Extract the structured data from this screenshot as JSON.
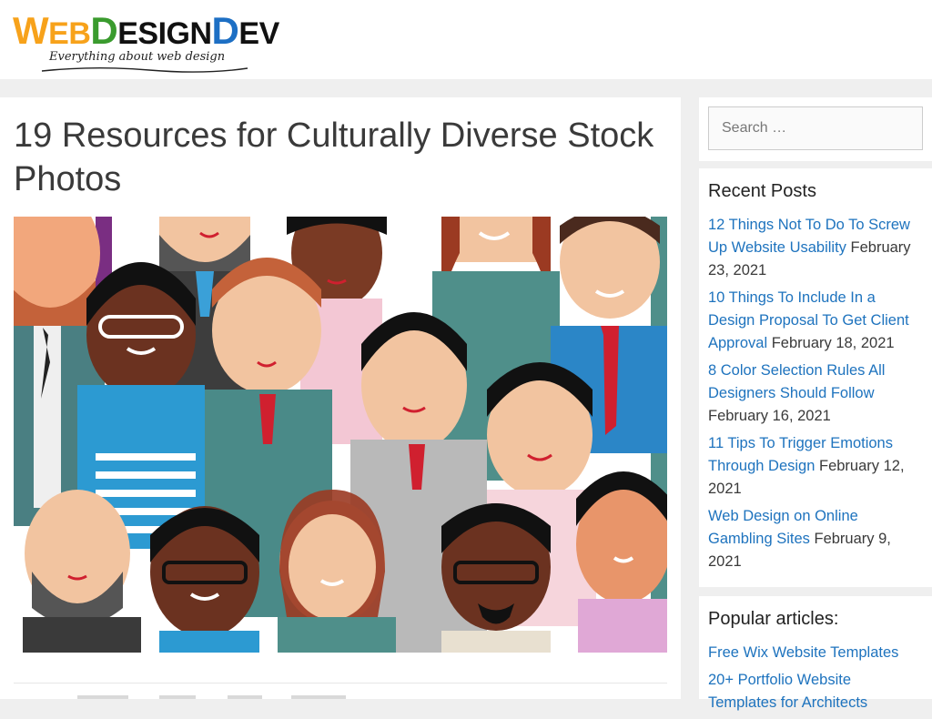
{
  "logo": {
    "letters": [
      {
        "t": "W",
        "big": true,
        "color": "#f7a21b"
      },
      {
        "t": "EB",
        "big": false,
        "color": "#f7a21b"
      },
      {
        "t": "D",
        "big": true,
        "color": "#3a9b2e"
      },
      {
        "t": "ESIGN",
        "big": false,
        "color": "#111111"
      },
      {
        "t": "D",
        "big": true,
        "color": "#1d6fc4"
      },
      {
        "t": "EV",
        "big": false,
        "color": "#111111"
      }
    ],
    "tagline": "Everything about web design"
  },
  "article": {
    "title": "19 Resources for Culturally Diverse Stock Photos",
    "image_alt": "Illustration of a diverse crowd of cartoon people"
  },
  "search": {
    "placeholder": "Search …"
  },
  "recent_posts": {
    "title": "Recent Posts",
    "items": [
      {
        "title": "12 Things Not To Do To Screw Up Website Usability",
        "date": "February 23, 2021"
      },
      {
        "title": "10 Things To Include In a Design Proposal To Get Client Approval",
        "date": "February 18, 2021"
      },
      {
        "title": "8 Color Selection Rules All Designers Should Follow",
        "date": "February 16, 2021"
      },
      {
        "title": "11 Tips To Trigger Emotions Through Design",
        "date": "February 12, 2021"
      },
      {
        "title": "Web Design on Online Gambling Sites",
        "date": "February 9, 2021"
      }
    ]
  },
  "popular_articles": {
    "title": "Popular articles:",
    "items": [
      {
        "title": "Free Wix Website Templates"
      },
      {
        "title": "20+ Portfolio Website Templates for Architects"
      }
    ]
  },
  "colors": {
    "link": "#1e73be",
    "background": "#efefef",
    "accent_tie": "#d0202f"
  }
}
